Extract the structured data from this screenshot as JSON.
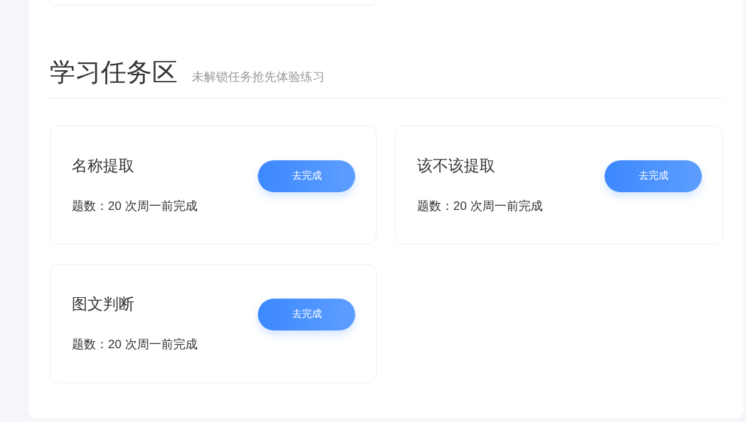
{
  "section": {
    "title": "学习任务区",
    "subtitle": "未解锁任务抢先体验练习"
  },
  "tasks": [
    {
      "title": "名称提取",
      "info": "题数：20 次周一前完成",
      "button": "去完成"
    },
    {
      "title": "该不该提取",
      "info": "题数：20 次周一前完成",
      "button": "去完成"
    },
    {
      "title": "图文判断",
      "info": "题数：20 次周一前完成",
      "button": "去完成"
    }
  ]
}
